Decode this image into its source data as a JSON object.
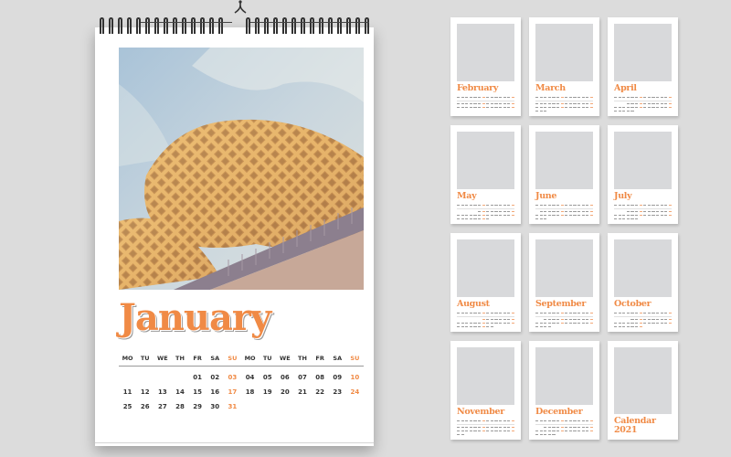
{
  "accent_color": "#f08a45",
  "main_calendar": {
    "month": "January",
    "photo_subject": "wooden-lattice-architecture-photo",
    "weekday_headers": [
      "MO",
      "TU",
      "WE",
      "TH",
      "FR",
      "SA",
      "SU",
      "MO",
      "TU",
      "WE",
      "TH",
      "FR",
      "SA",
      "SU"
    ],
    "weeks": [
      [
        "",
        "",
        "",
        "",
        "01",
        "02",
        "03",
        "04",
        "05",
        "06",
        "07",
        "08",
        "09",
        "10"
      ],
      [
        "11",
        "12",
        "13",
        "14",
        "15",
        "16",
        "17",
        "18",
        "19",
        "20",
        "21",
        "22",
        "23",
        "24"
      ],
      [
        "25",
        "26",
        "27",
        "28",
        "29",
        "30",
        "31",
        "",
        "",
        "",
        "",
        "",
        "",
        ""
      ]
    ]
  },
  "mini_cards": [
    {
      "label": "February",
      "start": 0,
      "days": 28
    },
    {
      "label": "March",
      "start": 0,
      "days": 31
    },
    {
      "label": "April",
      "start": 3,
      "days": 30
    },
    {
      "label": "May",
      "start": 5,
      "days": 31
    },
    {
      "label": "June",
      "start": 1,
      "days": 30
    },
    {
      "label": "July",
      "start": 3,
      "days": 31
    },
    {
      "label": "August",
      "start": 6,
      "days": 31
    },
    {
      "label": "September",
      "start": 2,
      "days": 30
    },
    {
      "label": "October",
      "start": 4,
      "days": 31
    },
    {
      "label": "November",
      "start": 0,
      "days": 30
    },
    {
      "label": "December",
      "start": 2,
      "days": 31
    },
    {
      "label": "Calendar 2021",
      "cover": true
    }
  ]
}
